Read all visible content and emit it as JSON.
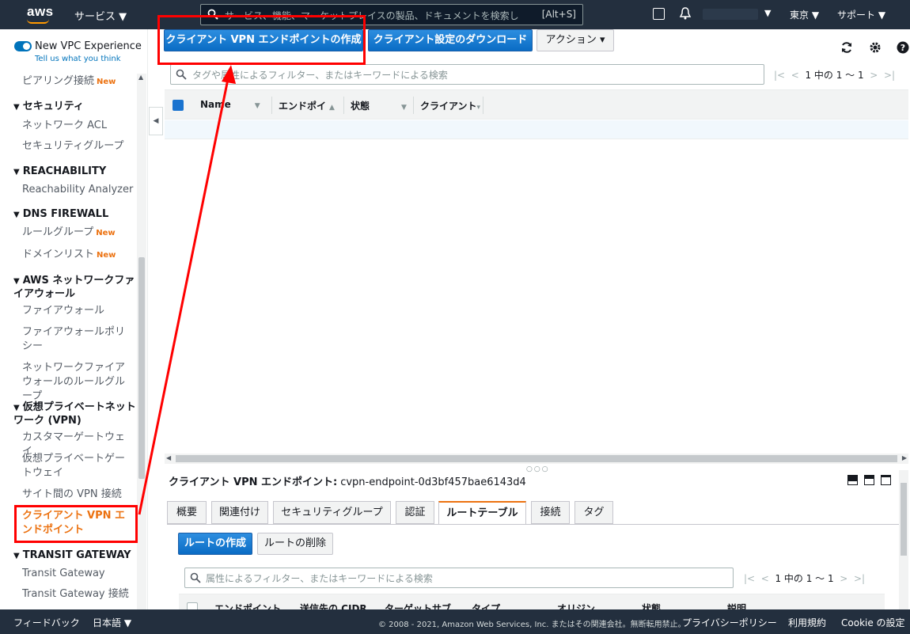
{
  "topnav": {
    "logo_text": "aws",
    "services": "サービス ▼",
    "search_placeholder": "サービス、機能、マーケットプレイスの製品、ドキュメントを検索し",
    "search_shortcut": "[Alt+S]",
    "account_caret": "▼",
    "region": "東京 ▼",
    "support": "サポート ▼"
  },
  "sidebar": {
    "vpc_experience": "New VPC Experience",
    "tell_us": "Tell us what you think",
    "new_badge": "New",
    "items": {
      "peering": "ピアリング接続",
      "sec_head": "セキュリティ",
      "nacl": "ネットワーク ACL",
      "sg": "セキュリティグループ",
      "reach_head": "REACHABILITY",
      "reach_analyzer": "Reachability Analyzer",
      "dns_head": "DNS FIREWALL",
      "rule_groups": "ルールグループ",
      "domain_lists": "ドメインリスト",
      "fw_head": "AWS ネットワークファイアウォール",
      "firewall": "ファイアウォール",
      "fw_policy": "ファイアウォールポリシー",
      "fw_rule_groups": "ネットワークファイアウォールのルールグループ",
      "vpn_head": "仮想プライベートネットワーク (VPN)",
      "cgw": "カスタマーゲートウェイ",
      "vgw": "仮想プライベートゲートウェイ",
      "s2s": "サイト間の VPN 接続",
      "cvpn": "クライアント VPN エンドポイント",
      "tgw_head": "TRANSIT GATEWAY",
      "tgw": "Transit Gateway",
      "tgw_attach": "Transit Gateway 接続"
    }
  },
  "toolbar": {
    "create_button": "クライアント VPN エンドポイントの作成",
    "download_button": "クライアント設定のダウンロード",
    "actions_button": "アクション ▾"
  },
  "filter": {
    "placeholder": "タグや属性によるフィルター、またはキーワードによる検索",
    "pager_text": "1 中の 1 〜 1"
  },
  "grid": {
    "columns": [
      "Name",
      "エンドポイ",
      "状態",
      "クライアント"
    ]
  },
  "detail": {
    "title": "クライアント VPN エンドポイント:",
    "endpoint_id": "cvpn-endpoint-0d3bf457bae6143d4",
    "tabs": [
      "概要",
      "関連付け",
      "セキュリティグループ",
      "認証",
      "ルートテーブル",
      "接続",
      "タグ"
    ],
    "create_route": "ルートの作成",
    "delete_route": "ルートの削除",
    "sub_filter_placeholder": "属性によるフィルター、またはキーワードによる検索",
    "sub_pager_text": "1 中の 1 〜 1",
    "sub_columns": [
      "エンドポイント",
      "送信先の CIDR",
      "ターゲットサブ",
      "タイプ",
      "オリジン",
      "状態",
      "説明"
    ]
  },
  "footer": {
    "feedback": "フィードバック",
    "language": "日本語 ▼",
    "copyright": "© 2008 - 2021, Amazon Web Services, Inc. またはその関連会社。無断転用禁止。",
    "privacy": "プライバシーポリシー",
    "terms": "利用規約",
    "cookie": "Cookie の設定"
  },
  "colors": {
    "nav_bg": "#232f3e",
    "primary_blue": "#0a6cc4",
    "accent_orange": "#ec7211",
    "annotation_red": "#ff0000"
  }
}
